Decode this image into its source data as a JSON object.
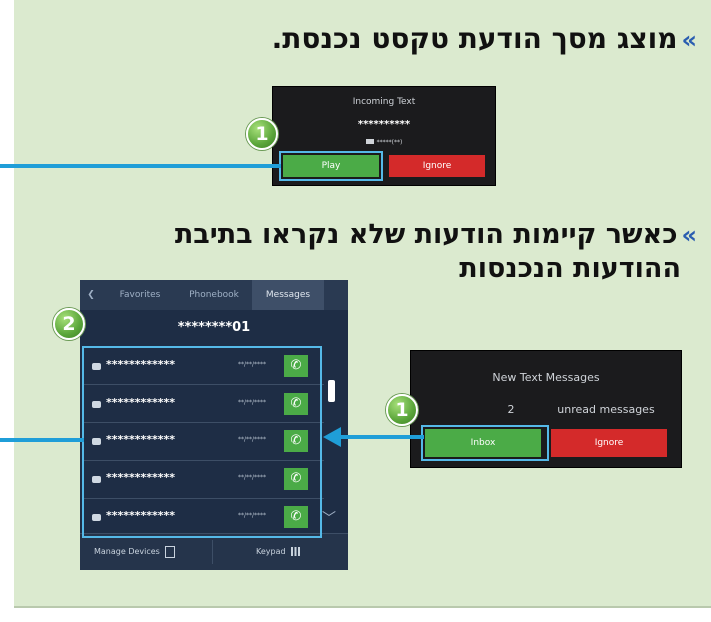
{
  "heading1": {
    "chevron": "»",
    "text": "מוצג מסך הודעת טקסט נכנסת."
  },
  "heading2": {
    "chevron": "»",
    "line1": "כאשר קיימות הודעות שלא נקראו בתיבת",
    "line2": "ההודעות הנכנסות"
  },
  "incoming_screen": {
    "title": "Incoming Text",
    "stars": "**********",
    "number": "*****(**)",
    "play_label": "Play",
    "ignore_label": "Ignore"
  },
  "new_messages_screen": {
    "title": "New Text Messages",
    "count": "2",
    "unread_label": "unread messages",
    "inbox_label": "Inbox",
    "ignore_label": "Ignore"
  },
  "phone": {
    "tabs": [
      "Favorites",
      "Phonebook",
      "Messages"
    ],
    "back_glyph": "❮",
    "contact": "********01",
    "rows": [
      {
        "icon": "message-icon",
        "stars": "************",
        "date": "**/**/****"
      },
      {
        "icon": "envelope-open-icon",
        "stars": "************",
        "date": "**/**/****"
      },
      {
        "icon": "envelope-open-icon",
        "stars": "************",
        "date": "**/**/****"
      },
      {
        "icon": "envelope-open-icon",
        "stars": "************",
        "date": "**/**/****"
      },
      {
        "icon": "envelope-open-icon",
        "stars": "************",
        "date": "**/**/****"
      }
    ],
    "call_glyph": "✆",
    "scroll_down_glyph": "﹀",
    "manage_devices": "Manage Devices",
    "keypad": "Keypad"
  },
  "badges": {
    "one": "1",
    "two": "2"
  },
  "colors": {
    "panel": "#dbeacf",
    "callout": "#1f9ed8",
    "green": "#4bab47",
    "red": "#d42a2a",
    "highlight": "#55b9e8"
  }
}
